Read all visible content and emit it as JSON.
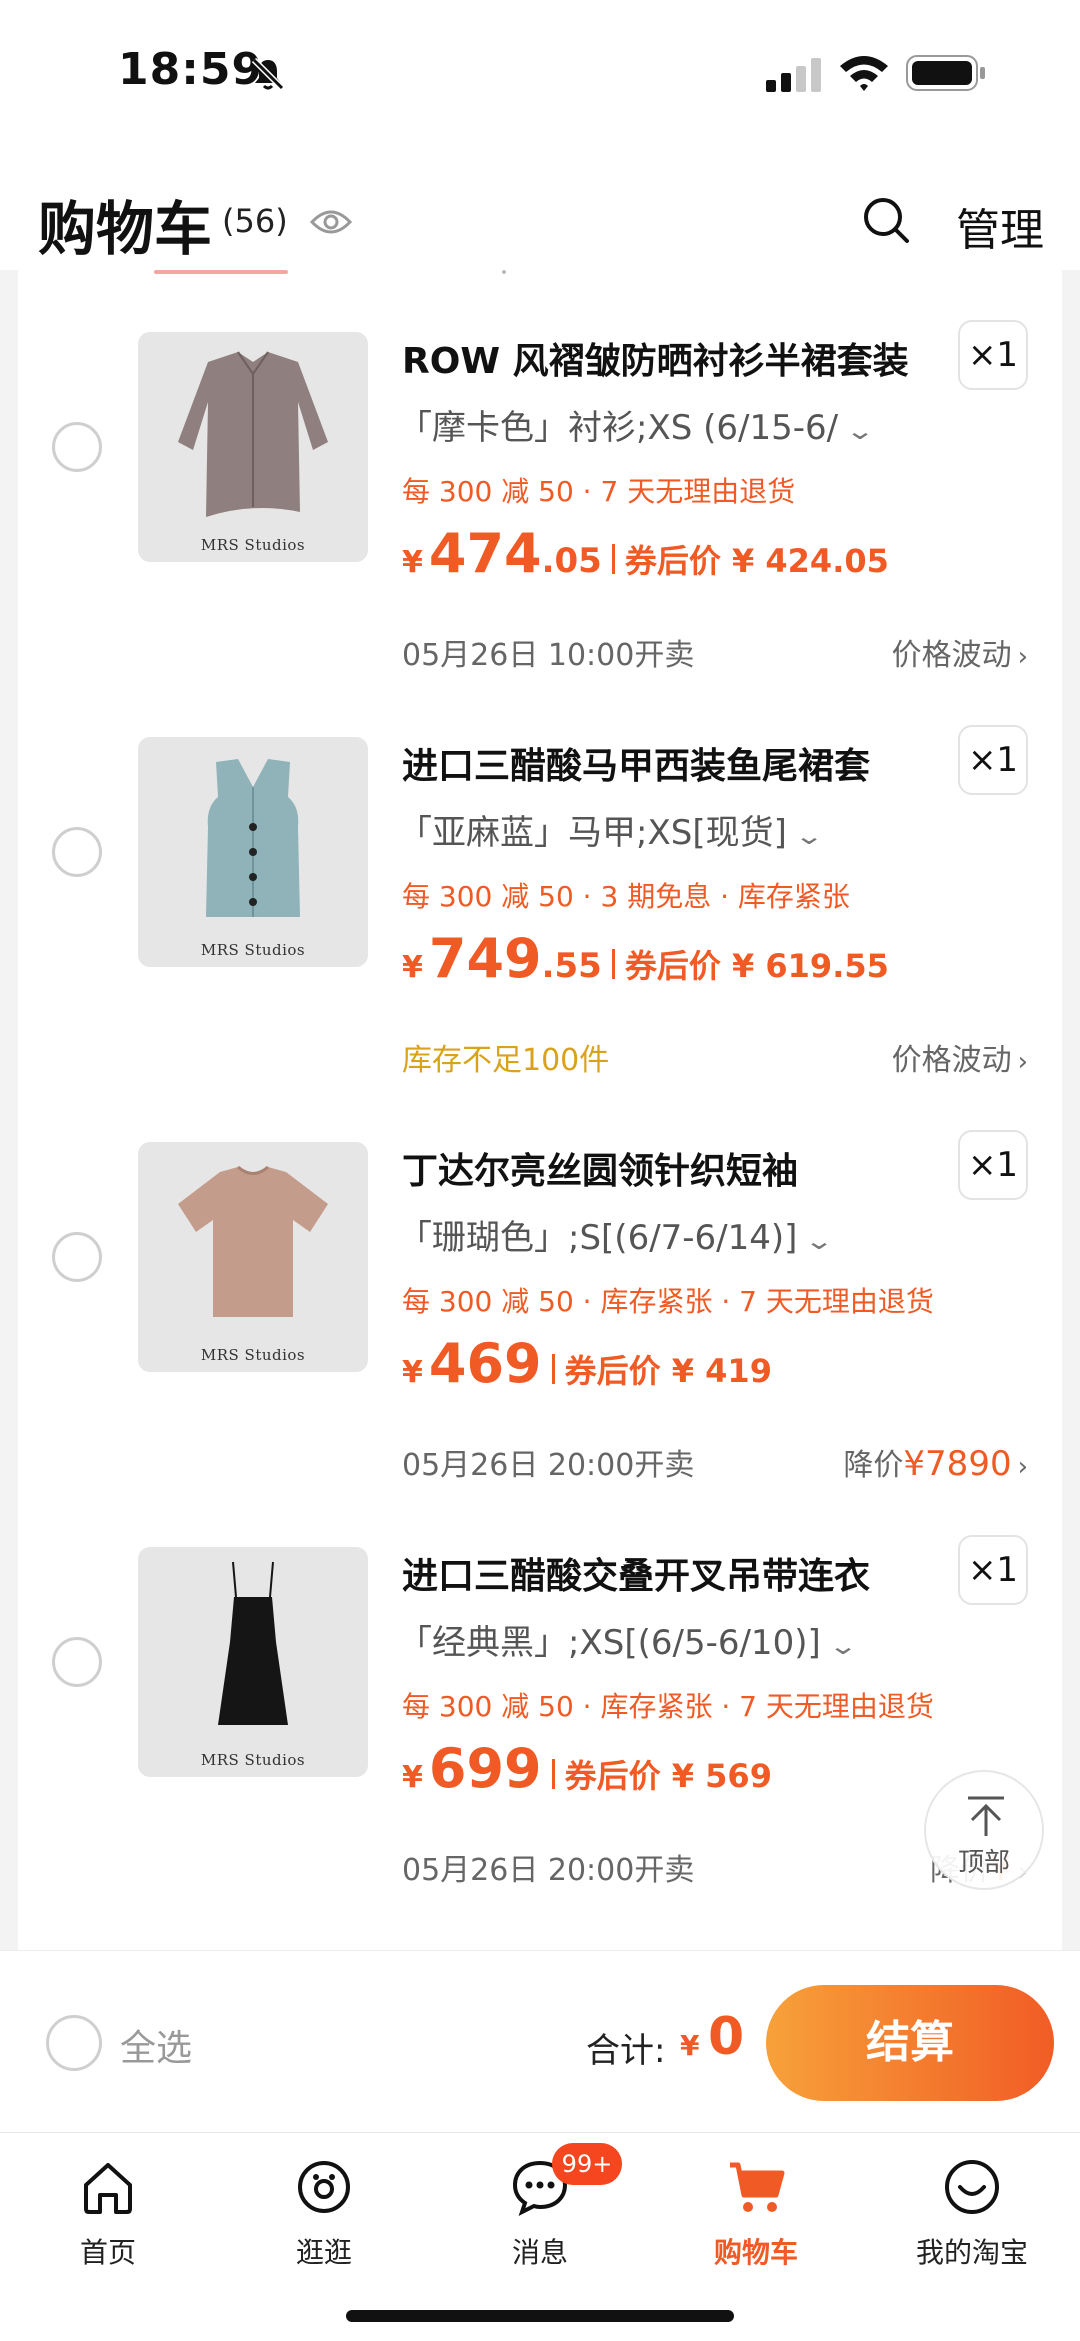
{
  "status_bar": {
    "time": "18:59"
  },
  "header": {
    "title": "购物车",
    "count": "(56)",
    "manage": "管理"
  },
  "items": [
    {
      "name": "ROW 风褶皱防晒衬衫半裙套装",
      "spec": "「摩卡色」衬衫;XS (6/15-6/",
      "qty": "×1",
      "promo": "每 300 减 50 · 7 天无理由退货",
      "price_symbol": "¥",
      "price_int": "474",
      "price_dec": ".05",
      "coupon": "券后价 ¥ 424.05",
      "meta": "05月26日 10:00开卖",
      "trend_label": "价格波动",
      "trend_value": "",
      "image_color": "#8f7f7e"
    },
    {
      "name": "进口三醋酸马甲西装鱼尾裙套",
      "spec": "「亚麻蓝」马甲;XS[现货]",
      "qty": "×1",
      "promo": "每 300 减 50 · 3 期免息 · 库存紧张",
      "price_symbol": "¥",
      "price_int": "749",
      "price_dec": ".55",
      "coupon": "券后价 ¥ 619.55",
      "meta": "库存不足100件",
      "trend_label": "价格波动",
      "trend_value": "",
      "image_color": "#8fb3b8"
    },
    {
      "name": "丁达尔亮丝圆领针织短袖",
      "spec": "「珊瑚色」;S[(6/7-6/14)]",
      "qty": "×1",
      "promo": "每 300 减 50 · 库存紧张 · 7 天无理由退货",
      "price_symbol": "¥",
      "price_int": "469",
      "price_dec": "",
      "coupon": "券后价 ¥ 419",
      "meta": "05月26日 20:00开卖",
      "trend_label": "降价",
      "trend_value": "¥7890",
      "image_color": "#c49c8b"
    },
    {
      "name": "进口三醋酸交叠开叉吊带连衣",
      "spec": "「经典黑」;XS[(6/5-6/10)]",
      "qty": "×1",
      "promo": "每 300 减 50 · 库存紧张 · 7 天无理由退货",
      "price_symbol": "¥",
      "price_int": "699",
      "price_dec": "",
      "coupon": "券后价 ¥ 569",
      "meta": "05月26日 20:00开卖",
      "trend_label": "降价",
      "trend_value": "¥",
      "image_color": "#151515"
    }
  ],
  "brand_text": "MRS Studios",
  "float_button": {
    "label": "顶部"
  },
  "checkout": {
    "select_all": "全选",
    "total_label": "合计:",
    "total_symbol": "¥",
    "total_value": "0",
    "button": "结算"
  },
  "tabs": [
    {
      "label": "首页",
      "icon": "home-icon"
    },
    {
      "label": "逛逛",
      "icon": "browse-icon"
    },
    {
      "label": "消息",
      "icon": "message-icon",
      "badge": "99+"
    },
    {
      "label": "购物车",
      "icon": "cart-icon",
      "active": true
    },
    {
      "label": "我的淘宝",
      "icon": "profile-icon"
    }
  ],
  "colors": {
    "accent": "#f05a24",
    "warning": "#d9a21b"
  }
}
